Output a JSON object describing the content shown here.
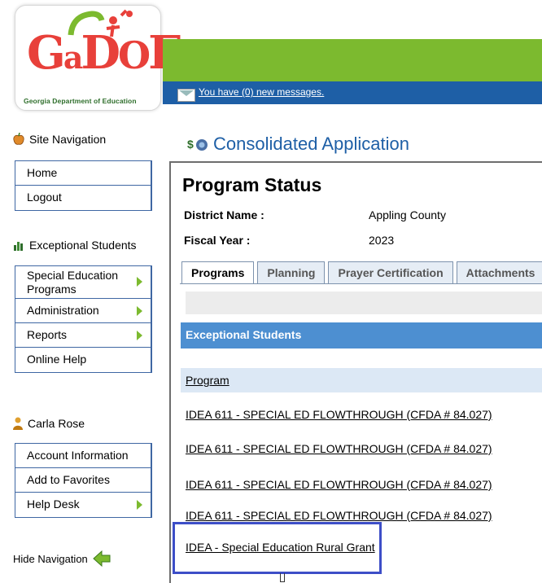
{
  "header": {
    "logo_word": "GaDOE",
    "logo_subtitle": "Georgia Department of Education",
    "messages_link": "You have (0) new messages."
  },
  "sidebar": {
    "site_nav": {
      "heading": "Site Navigation",
      "items": [
        {
          "label": "Home",
          "arrow": false
        },
        {
          "label": "Logout",
          "arrow": false
        }
      ]
    },
    "exceptional": {
      "heading": "Exceptional Students",
      "items": [
        {
          "label": "Special Education Programs",
          "arrow": true
        },
        {
          "label": "Administration",
          "arrow": true
        },
        {
          "label": "Reports",
          "arrow": true
        },
        {
          "label": "Online Help",
          "arrow": false
        }
      ]
    },
    "user": {
      "heading": "Carla Rose",
      "items": [
        {
          "label": "Account Information",
          "arrow": false
        },
        {
          "label": "Add to Favorites",
          "arrow": false
        },
        {
          "label": "Help Desk",
          "arrow": true
        }
      ]
    },
    "hide_nav": "Hide Navigation"
  },
  "main": {
    "app_title": "Consolidated Application",
    "page_title": "Program Status",
    "district_label": "District Name :",
    "district_value": "Appling County",
    "fiscal_label": "Fiscal Year :",
    "fiscal_value": "2023",
    "tabs": [
      "Programs",
      "Planning",
      "Prayer Certification",
      "Attachments"
    ],
    "active_tab": "Programs",
    "section_title": "Exceptional Students",
    "program_column": "Program",
    "programs": [
      "IDEA 611 - SPECIAL ED FLOWTHROUGH (CFDA # 84.027)",
      "IDEA 611 - SPECIAL ED FLOWTHROUGH (CFDA # 84.027)",
      "IDEA 611 - SPECIAL ED FLOWTHROUGH (CFDA # 84.027)",
      "IDEA - Special Education Rural Grant"
    ]
  },
  "colors": {
    "green_bar": "#7cba2f",
    "blue_bar": "#1e5fa6",
    "section_bar": "#4d8fd1",
    "highlight_box": "#3d4ec7"
  }
}
